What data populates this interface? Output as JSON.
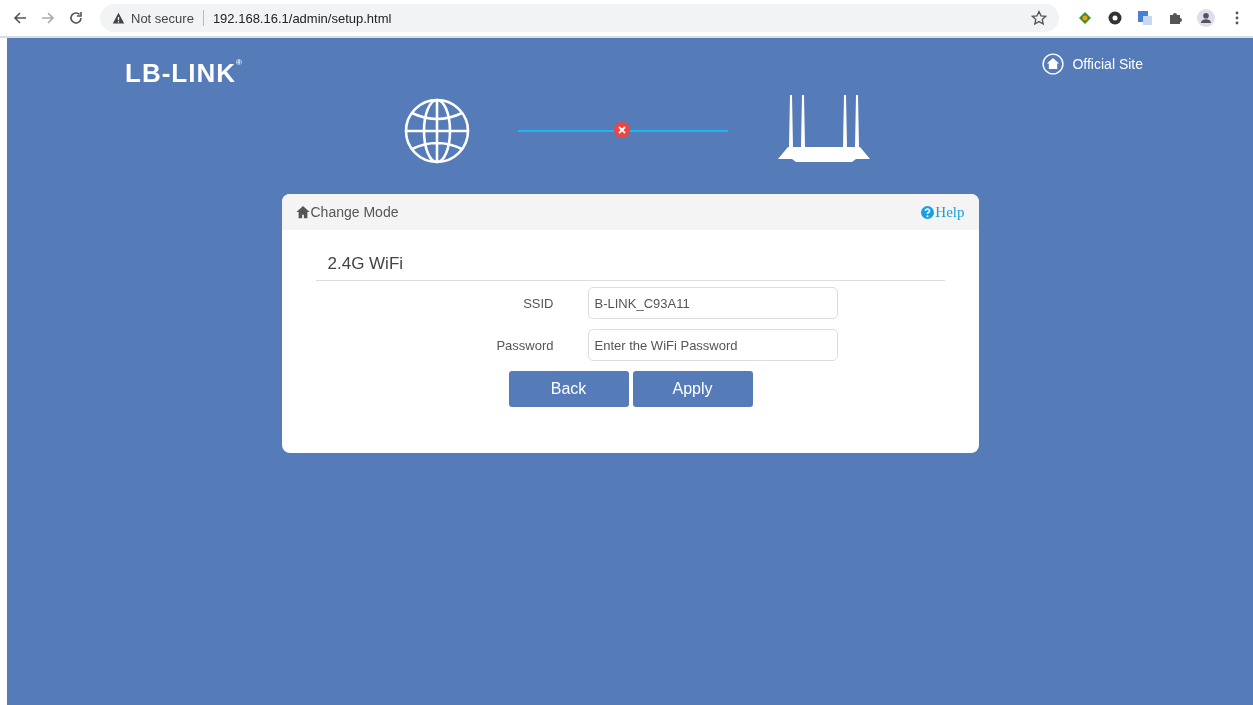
{
  "browser": {
    "security": "Not secure",
    "url": "192.168.16.1/admin/setup.html"
  },
  "header": {
    "logo": "LB-LINK",
    "logo_mark": "®",
    "official_site": "Official Site"
  },
  "connection": {
    "connected": false
  },
  "panel": {
    "title": "Change Mode",
    "help": "Help",
    "section": "2.4G WiFi",
    "fields": [
      {
        "label": "SSID",
        "value": "B-LINK_C93A11"
      },
      {
        "label": "Password",
        "placeholder": "Enter the WiFi Password"
      }
    ],
    "buttons": [
      "Back",
      "Apply"
    ]
  }
}
